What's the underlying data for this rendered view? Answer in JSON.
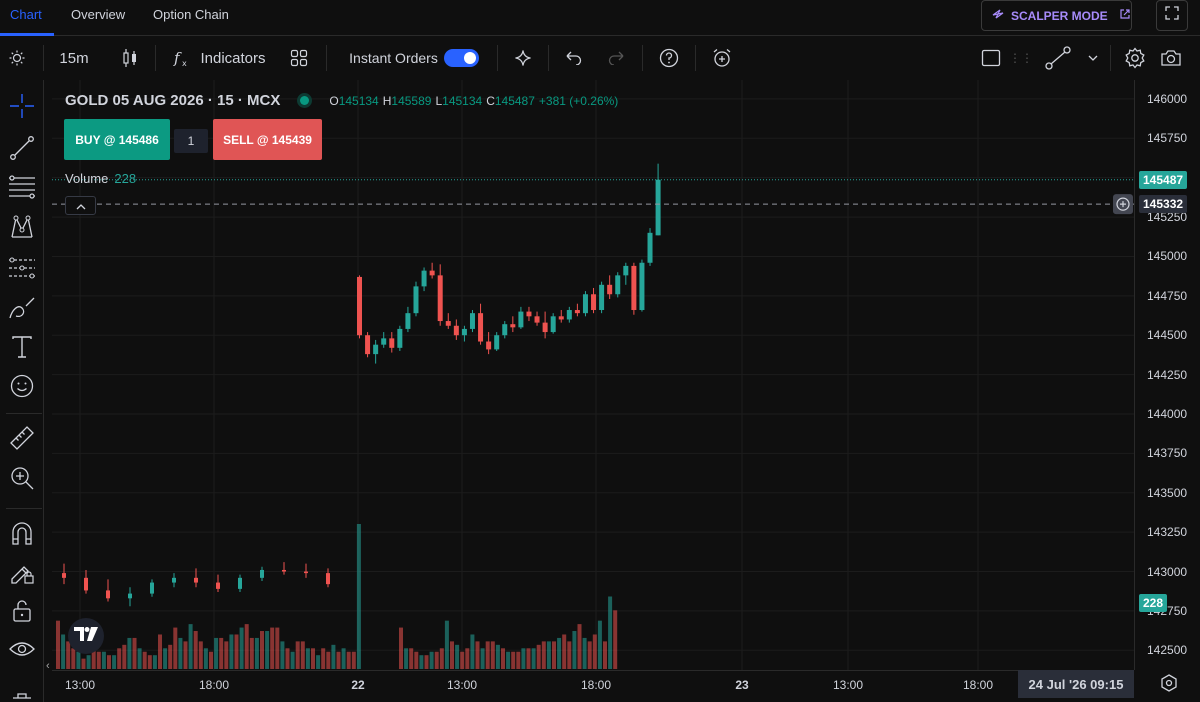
{
  "tabs": [
    {
      "label": "Chart",
      "active": true
    },
    {
      "label": "Overview",
      "active": false
    },
    {
      "label": "Option Chain",
      "active": false
    }
  ],
  "scalper_label": "SCALPER MODE",
  "toolbar": {
    "interval": "15m",
    "indicators_label": "Indicators",
    "instant_orders_label": "Instant Orders",
    "instant_orders_on": true
  },
  "legend": {
    "symbol": "GOLD 05 AUG 2026 · 15 · MCX",
    "o_label": "O",
    "o_value": "145134",
    "h_label": "H",
    "h_value": "145589",
    "l_label": "L",
    "l_value": "145134",
    "c_label": "C",
    "c_value": "145487",
    "change": "+381 (+0.26%)"
  },
  "trade": {
    "buy_label": "BUY @ 145486",
    "quantity": "1",
    "sell_label": "SELL @ 145439"
  },
  "volume": {
    "label": "Volume",
    "value": "228"
  },
  "price_axis": {
    "ticks": [
      "146000",
      "145750",
      "145500",
      "145250",
      "145000",
      "144750",
      "144500",
      "144250",
      "144000",
      "143750",
      "143500",
      "143250",
      "143000",
      "142750",
      "142500"
    ],
    "last_price": "145487",
    "crosshair_price": "145332",
    "volume_badge": "228"
  },
  "time_axis": {
    "labels": [
      "13:00",
      "18:00",
      "22",
      "13:00",
      "18:00",
      "23",
      "13:00",
      "18:00"
    ],
    "crosshair_time": "24 Jul '26   09:15"
  },
  "colors": {
    "up": "#26a69a",
    "down": "#ef5350",
    "accent": "#2962ff",
    "scalper": "#a78bfa"
  },
  "icons": [
    "brightness-icon",
    "candles-icon",
    "fx-icon",
    "layouts-icon",
    "sparkle-icon",
    "undo-icon",
    "redo-icon",
    "help-icon",
    "alert-icon",
    "rectangle-icon",
    "line-tool-icon",
    "settings-icon",
    "camera-icon",
    "crosshair-icon",
    "trendline-icon",
    "fib-icon",
    "pattern-icon",
    "projection-icon",
    "brush-icon",
    "text-icon",
    "emoji-icon",
    "ruler-icon",
    "zoom-icon",
    "magnet-icon",
    "lock-drawing-icon",
    "lock-icon",
    "eye-icon"
  ],
  "chart_data": {
    "type": "candlestick",
    "ylim": [
      142375,
      146120
    ],
    "candles": [
      [
        144870,
        144880,
        144480,
        144500
      ],
      [
        144500,
        144520,
        144360,
        144380
      ],
      [
        144380,
        144470,
        144320,
        144440
      ],
      [
        144440,
        144520,
        144420,
        144480
      ],
      [
        144480,
        144520,
        144390,
        144420
      ],
      [
        144420,
        144560,
        144400,
        144540
      ],
      [
        144540,
        144680,
        144520,
        144640
      ],
      [
        144640,
        144840,
        144620,
        144810
      ],
      [
        144810,
        144930,
        144780,
        144910
      ],
      [
        144910,
        144960,
        144860,
        144880
      ],
      [
        144880,
        144950,
        144560,
        144590
      ],
      [
        144590,
        144640,
        144540,
        144560
      ],
      [
        144560,
        144600,
        144470,
        144500
      ],
      [
        144500,
        144560,
        144460,
        144540
      ],
      [
        144540,
        144660,
        144520,
        144640
      ],
      [
        144640,
        144700,
        144440,
        144460
      ],
      [
        144460,
        144520,
        144380,
        144410
      ],
      [
        144410,
        144520,
        144400,
        144500
      ],
      [
        144500,
        144590,
        144480,
        144570
      ],
      [
        144570,
        144620,
        144520,
        144550
      ],
      [
        144550,
        144680,
        144540,
        144650
      ],
      [
        144650,
        144680,
        144590,
        144620
      ],
      [
        144620,
        144650,
        144560,
        144580
      ],
      [
        144580,
        144650,
        144480,
        144520
      ],
      [
        144520,
        144640,
        144510,
        144620
      ],
      [
        144620,
        144660,
        144580,
        144600
      ],
      [
        144600,
        144680,
        144580,
        144660
      ],
      [
        144660,
        144700,
        144620,
        144640
      ],
      [
        144640,
        144780,
        144620,
        144760
      ],
      [
        144760,
        144800,
        144640,
        144660
      ],
      [
        144660,
        144840,
        144640,
        144820
      ],
      [
        144820,
        144880,
        144730,
        144760
      ],
      [
        144760,
        144900,
        144740,
        144880
      ],
      [
        144880,
        144960,
        144820,
        144940
      ],
      [
        144940,
        144960,
        144630,
        144660
      ],
      [
        144660,
        144980,
        144650,
        144960
      ],
      [
        144960,
        145180,
        144940,
        145150
      ],
      [
        145134,
        145589,
        145134,
        145487
      ]
    ],
    "volume_day1": [
      14,
      10,
      8,
      6,
      5,
      3,
      4,
      7,
      5,
      5,
      4,
      4,
      6,
      7,
      9,
      9,
      6,
      5,
      4,
      4,
      10,
      6,
      7,
      12,
      9,
      8,
      13,
      11,
      8,
      6,
      5,
      9,
      9,
      8,
      10,
      10,
      12,
      13,
      9,
      9,
      11,
      11,
      12,
      12,
      8,
      6,
      5,
      8,
      8,
      6,
      6,
      4,
      6,
      5,
      7,
      5,
      6,
      5,
      5,
      42
    ],
    "volume_day2": [
      12,
      6,
      6,
      5,
      4,
      4,
      5,
      5,
      6,
      14,
      8,
      7,
      5,
      6,
      10,
      8,
      6,
      8,
      8,
      7,
      6,
      5,
      5,
      5,
      6,
      6,
      6,
      7,
      8,
      8,
      8,
      9,
      10,
      8,
      11,
      13,
      9,
      8,
      10,
      14,
      8,
      21,
      17
    ]
  }
}
